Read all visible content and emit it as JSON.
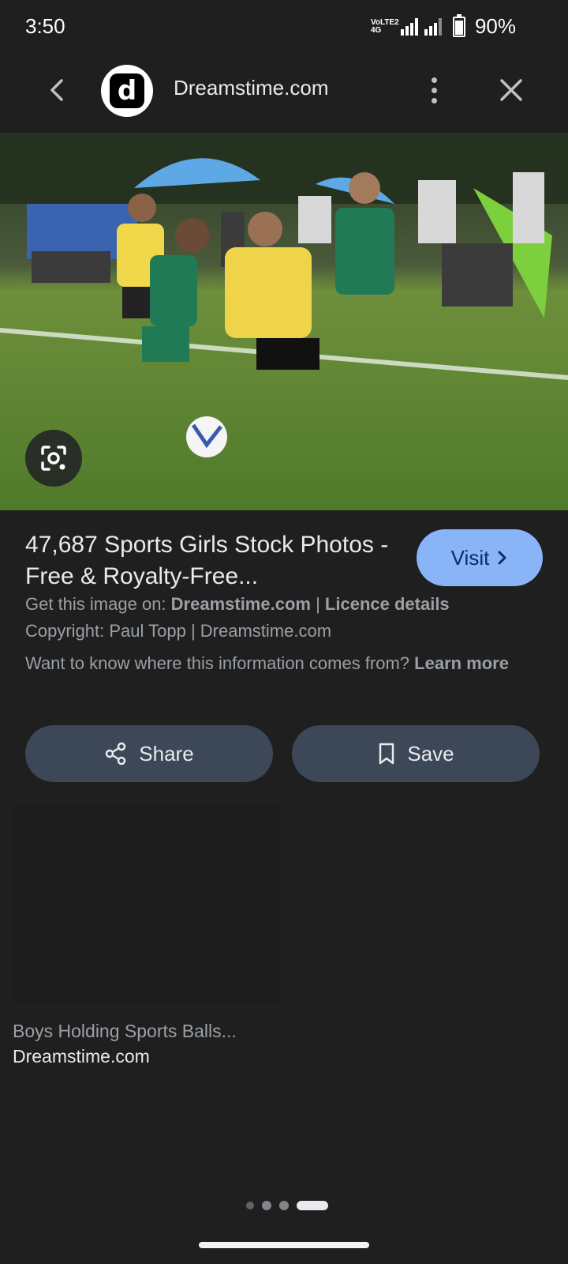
{
  "status_bar": {
    "time": "3:50",
    "network_label": "VoLTE2 4G",
    "battery": "90%"
  },
  "top_bar": {
    "site_logo_letter": "d",
    "site_name": "Dreamstime.com"
  },
  "result": {
    "title": "47,687 Sports Girls Stock Photos - Free & Royalty-Free...",
    "visit_label": "Visit",
    "get_image_prefix": "Get this image on: ",
    "get_image_source": "Dreamstime.com",
    "separator": " | ",
    "licence_link": "Licence details",
    "copyright": "Copyright: Paul Topp | Dreamstime.com",
    "info_question": "Want to know where this information comes from? ",
    "learn_more": "Learn more"
  },
  "actions": {
    "share_label": "Share",
    "save_label": "Save"
  },
  "related": {
    "title": "Boys Holding Sports Balls...",
    "source": "Dreamstime.com"
  },
  "pager": {
    "page_count": 4,
    "active_index": 3
  },
  "icons": {
    "back": "chevron-left-icon",
    "more": "more-vert-icon",
    "close": "close-icon",
    "lens": "google-lens-icon",
    "visit": "chevron-right-icon",
    "share": "share-icon",
    "save": "bookmark-icon"
  },
  "colors": {
    "background": "#1f1f1f",
    "visit_button": "#8ab4f8",
    "action_button": "#3c4757"
  }
}
